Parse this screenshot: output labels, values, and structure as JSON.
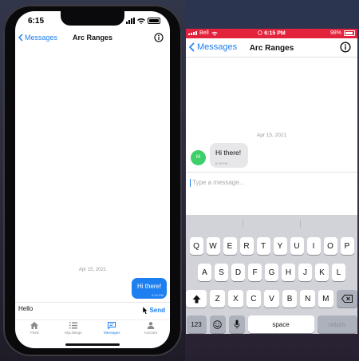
{
  "left_phone": {
    "status": {
      "time": "6:15"
    },
    "nav": {
      "back_label": "Messages",
      "title": "Arc Ranges"
    },
    "chat": {
      "date": "Apr 15, 2021",
      "sent_message": {
        "text": "Hi there!",
        "time": "6:15 PM"
      }
    },
    "composer": {
      "value": "Hello",
      "send_label": "Send"
    },
    "tabs": [
      {
        "label": "Feed",
        "icon": "home-icon"
      },
      {
        "label": "MyListings",
        "icon": "list-icon"
      },
      {
        "label": "Messages",
        "icon": "chat-icon",
        "active": true
      },
      {
        "label": "Account",
        "icon": "person-icon"
      }
    ]
  },
  "right_phone": {
    "status": {
      "carrier": "Bell",
      "time": "6:15 PM",
      "battery": "98%"
    },
    "nav": {
      "back_label": "Messages",
      "title": "Arc Ranges"
    },
    "chat": {
      "date": "Apr 15, 2021",
      "avatar_initials": "M",
      "received_message": {
        "text": "Hi there!",
        "time": "6:15 PM"
      }
    },
    "composer": {
      "placeholder": "Type a message..."
    },
    "keyboard": {
      "row1": [
        "Q",
        "W",
        "E",
        "R",
        "T",
        "Y",
        "U",
        "I",
        "O",
        "P"
      ],
      "row2": [
        "A",
        "S",
        "D",
        "F",
        "G",
        "H",
        "J",
        "K",
        "L"
      ],
      "row3": [
        "Z",
        "X",
        "C",
        "V",
        "B",
        "N",
        "M"
      ],
      "numbers_label": "123",
      "space_label": "space",
      "return_label": "return"
    }
  },
  "colors": {
    "accent": "#1e7ff0",
    "status_bar": "#e3223c",
    "avatar": "#3fcf6a"
  }
}
